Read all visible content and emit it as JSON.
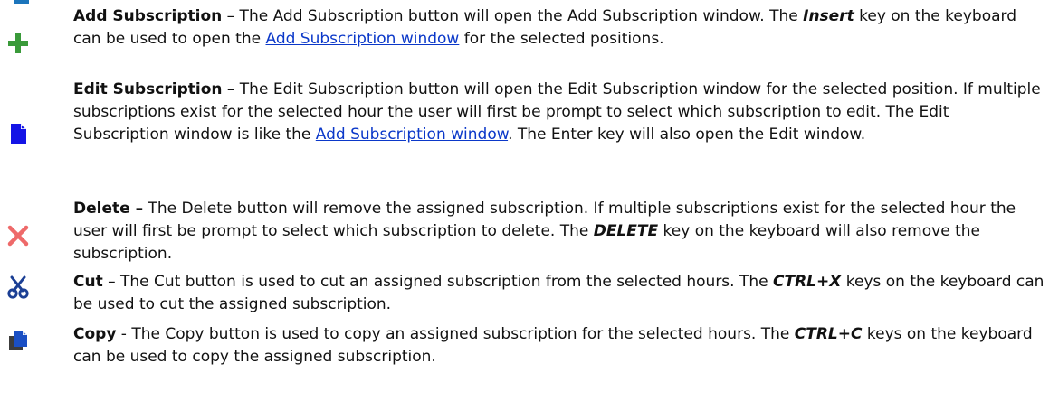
{
  "items": [
    {
      "icon": "add-icon",
      "title": "Add Subscription",
      "t1": " – The Add Subscription button will open the Add Subscription window. The ",
      "k1": "Insert",
      "t2": " key on the keyboard can be used to open the ",
      "link": "Add Subscription window",
      "t3": " for the selected positions."
    },
    {
      "icon": "edit-icon",
      "title": "Edit Subscription",
      "t1": " – The Edit Subscription button will open the Edit Subscription window for the selected position. If multiple subscriptions exist for the selected hour the user will first be prompt to select which subscription to edit. The Edit Subscription window is like the ",
      "link": "Add Subscription window",
      "t2": ". The Enter key will also open the Edit window."
    },
    {
      "icon": "delete-icon",
      "title": "Delete –",
      "t1": " The Delete button will remove the assigned subscription. If multiple subscriptions exist for the selected hour the user will first be prompt to select which subscription to delete. The ",
      "k1": "DELETE",
      "t2": " key on the keyboard will also remove the subscription."
    },
    {
      "icon": "cut-icon",
      "title": "Cut",
      "t1": " – The Cut button is used to cut an assigned subscription from the selected hours. The ",
      "k1": "CTRL+X",
      "t2": " keys on the keyboard can be used to cut the assigned subscription."
    },
    {
      "icon": "copy-icon",
      "title": "Copy",
      "t1": " - The Copy button is used to copy an assigned subscription for the selected hours. The ",
      "k1": "CTRL+C",
      "t2": " keys on the keyboard can be used to copy the assigned subscription."
    }
  ],
  "colors": {
    "add": "#3a9a3a",
    "edit": "#1414e6",
    "delete": "#ee6a6a",
    "cut": "#1b3f94",
    "copy": "#1a4fc4",
    "link": "#0b38c9"
  }
}
